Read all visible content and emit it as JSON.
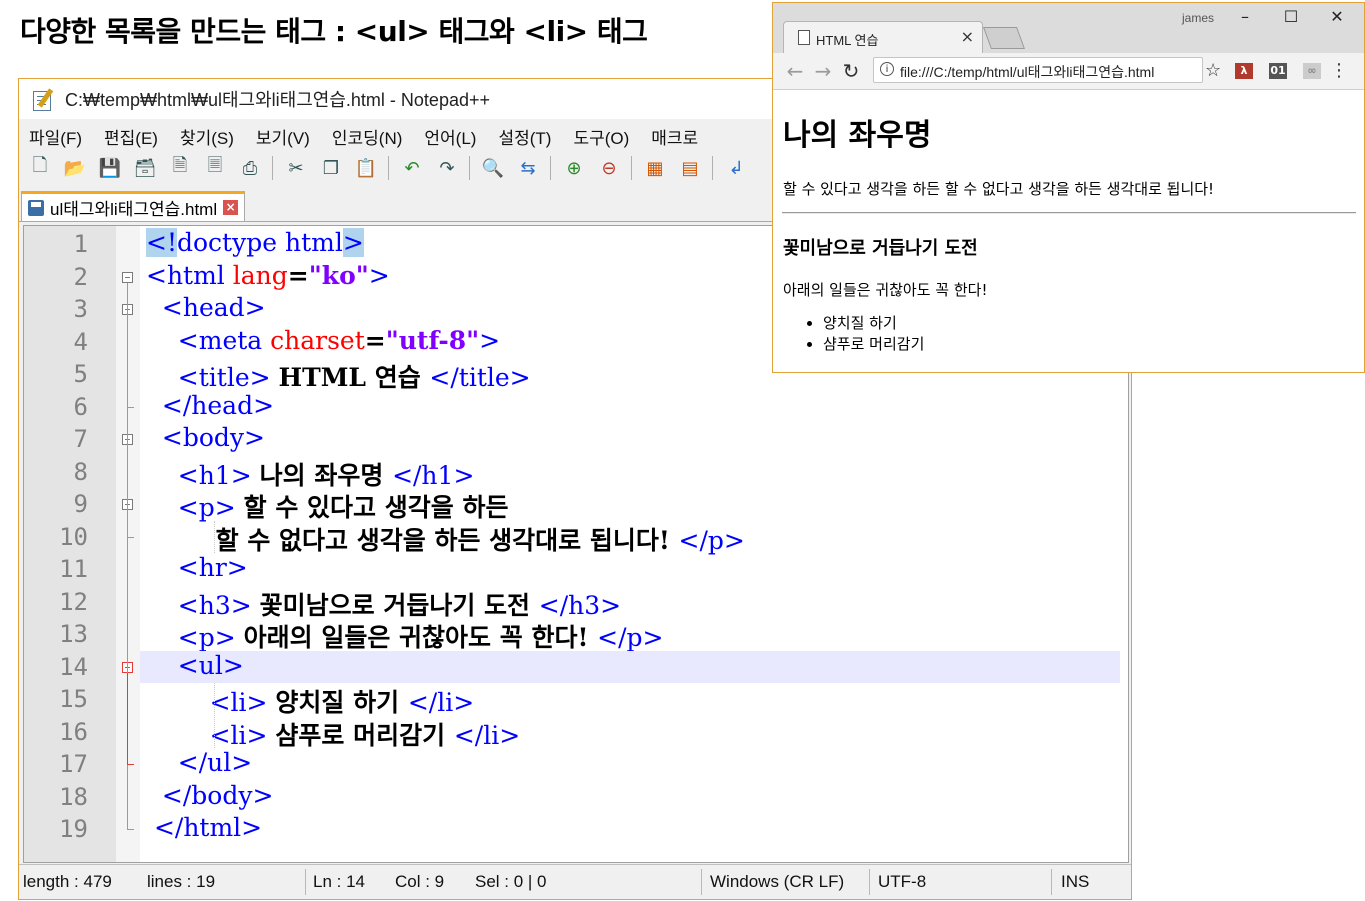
{
  "slide_title": "다양한 목록을 만드는 태그 : <ul> 태그와 <li> 태그",
  "notepad": {
    "title": "C:₩temp₩html₩ul태그와li태그연습.html - Notepad++",
    "menu": [
      "파일(F)",
      "편집(E)",
      "찾기(S)",
      "보기(V)",
      "인코딩(N)",
      "언어(L)",
      "설정(T)",
      "도구(O)",
      "매크로"
    ],
    "toolbar_icons": [
      "new-file-icon",
      "open-file-icon",
      "save-icon",
      "save-all-icon",
      "close-icon",
      "close-all-icon",
      "print-icon",
      "cut-icon",
      "copy-icon",
      "paste-icon",
      "undo-icon",
      "redo-icon",
      "find-icon",
      "replace-icon",
      "zoom-in-icon",
      "zoom-out-icon",
      "sync-v-icon",
      "sync-h-icon",
      "wrap-icon"
    ],
    "tab_label": "ul태그와li태그연습.html",
    "lines": [
      {
        "n": "1",
        "tokens": [
          {
            "t": "<!",
            "c": "tag hl"
          },
          {
            "t": "doctype html",
            "c": "tag"
          },
          {
            "t": ">",
            "c": "tag hl"
          }
        ]
      },
      {
        "n": "2",
        "tokens": [
          {
            "t": "<html ",
            "c": "tag"
          },
          {
            "t": "lang",
            "c": "attr"
          },
          {
            "t": "=",
            "c": "txt"
          },
          {
            "t": "\"ko\"",
            "c": "val"
          },
          {
            "t": ">",
            "c": "tag"
          }
        ]
      },
      {
        "n": "3",
        "tokens": [
          {
            "t": "  <head>",
            "c": "tag"
          }
        ]
      },
      {
        "n": "4",
        "tokens": [
          {
            "t": "    <meta ",
            "c": "tag"
          },
          {
            "t": "charset",
            "c": "attr"
          },
          {
            "t": "=",
            "c": "txt"
          },
          {
            "t": "\"utf-8\"",
            "c": "val"
          },
          {
            "t": ">",
            "c": "tag"
          }
        ]
      },
      {
        "n": "5",
        "tokens": [
          {
            "t": "    <title> ",
            "c": "tag"
          },
          {
            "t": "HTML 연습 ",
            "c": "txt"
          },
          {
            "t": "</title>",
            "c": "tag"
          }
        ]
      },
      {
        "n": "6",
        "tokens": [
          {
            "t": "  </head>",
            "c": "tag"
          }
        ]
      },
      {
        "n": "7",
        "tokens": [
          {
            "t": "  <body>",
            "c": "tag"
          }
        ]
      },
      {
        "n": "8",
        "tokens": [
          {
            "t": "    <h1> ",
            "c": "tag"
          },
          {
            "t": "나의 좌우명 ",
            "c": "txt"
          },
          {
            "t": "</h1>",
            "c": "tag"
          }
        ]
      },
      {
        "n": "9",
        "tokens": [
          {
            "t": "    <p> ",
            "c": "tag"
          },
          {
            "t": "할 수 있다고 생각을 하든",
            "c": "txt"
          }
        ]
      },
      {
        "n": "10",
        "tokens": [
          {
            "t": "        ",
            "c": "txt"
          },
          {
            "t": "할 수 없다고 생각을 하든 생각대로 됩니다! ",
            "c": "txt"
          },
          {
            "t": "</p>",
            "c": "tag"
          }
        ]
      },
      {
        "n": "11",
        "tokens": [
          {
            "t": "    <hr>",
            "c": "tag"
          }
        ]
      },
      {
        "n": "12",
        "tokens": [
          {
            "t": "    <h3> ",
            "c": "tag"
          },
          {
            "t": "꽃미남으로 거듭나기 도전 ",
            "c": "txt"
          },
          {
            "t": "</h3>",
            "c": "tag"
          }
        ]
      },
      {
        "n": "13",
        "tokens": [
          {
            "t": "    <p> ",
            "c": "tag"
          },
          {
            "t": "아래의 일들은 귀찮아도 꼭 한다! ",
            "c": "txt"
          },
          {
            "t": "</p>",
            "c": "tag"
          }
        ]
      },
      {
        "n": "14",
        "tokens": [
          {
            "t": "    <ul>",
            "c": "tag"
          }
        ]
      },
      {
        "n": "15",
        "tokens": [
          {
            "t": "        <li> ",
            "c": "tag"
          },
          {
            "t": "양치질 하기 ",
            "c": "txt"
          },
          {
            "t": "</li>",
            "c": "tag"
          }
        ]
      },
      {
        "n": "16",
        "tokens": [
          {
            "t": "        <li> ",
            "c": "tag"
          },
          {
            "t": "샴푸로 머리감기 ",
            "c": "txt"
          },
          {
            "t": "</li>",
            "c": "tag"
          }
        ]
      },
      {
        "n": "17",
        "tokens": [
          {
            "t": "    </ul>",
            "c": "tag"
          }
        ]
      },
      {
        "n": "18",
        "tokens": [
          {
            "t": "  </body>",
            "c": "tag"
          }
        ]
      },
      {
        "n": "19",
        "tokens": [
          {
            "t": " </html>",
            "c": "tag"
          }
        ]
      }
    ],
    "highlighted_line": 14,
    "status": {
      "length": "length : 479",
      "lines": "lines : 19",
      "ln": "Ln : 14",
      "col": "Col : 9",
      "sel": "Sel : 0 | 0",
      "eol": "Windows (CR LF)",
      "encoding": "UTF-8",
      "mode": "INS"
    }
  },
  "chrome": {
    "tab_title": "HTML 연습",
    "user": "james",
    "address": "file:///C:/temp/html/ul태그와li태그연습.html",
    "page": {
      "h1": "나의 좌우명",
      "p1": "할 수 있다고 생각을 하든 할 수 없다고 생각을 하든 생각대로 됩니다!",
      "h3": "꽃미남으로 거듭나기 도전",
      "p2": "아래의 일들은 귀찮아도 꼭 한다!",
      "list": [
        "양치질 하기",
        "샴푸로 머리감기"
      ]
    }
  },
  "colors": {
    "tag": "#0000ff",
    "attr": "#ff0000",
    "value": "#8000ff",
    "active_tab_accent": "#f5a623",
    "current_line": "#e8e8ff"
  }
}
